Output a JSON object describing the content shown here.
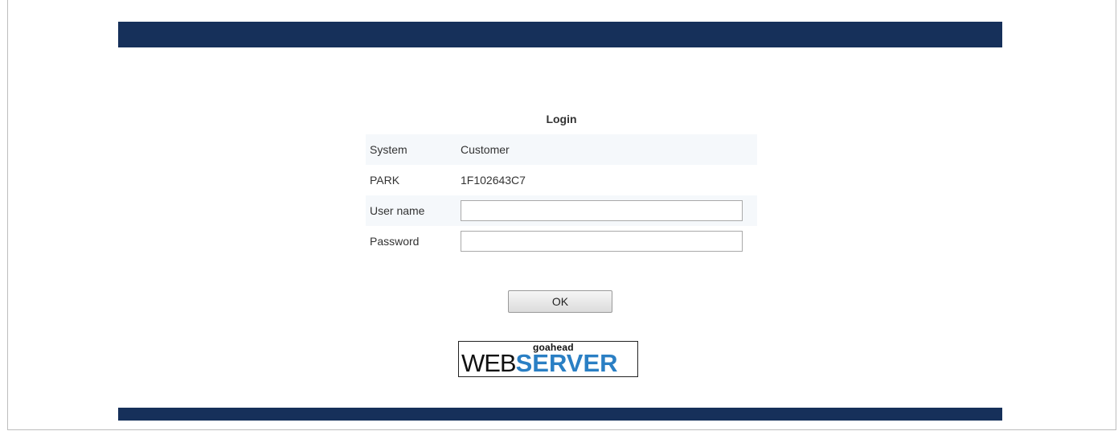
{
  "login": {
    "title": "Login",
    "rows": [
      {
        "label": "System",
        "value": "Customer"
      },
      {
        "label": "PARK",
        "value": "1F102643C7"
      }
    ],
    "username": {
      "label": "User name",
      "value": "",
      "placeholder": ""
    },
    "password": {
      "label": "Password",
      "value": "",
      "placeholder": ""
    },
    "ok_label": "OK"
  },
  "logo": {
    "small_text": "goahead",
    "web_text": "WEB",
    "server_text": "SERVER"
  },
  "colors": {
    "header_bar": "#16305a",
    "row_shade": "#f5f8fb",
    "logo_server": "#2a7fc4"
  }
}
